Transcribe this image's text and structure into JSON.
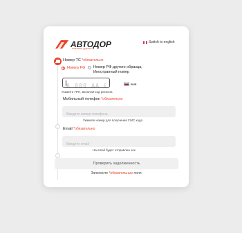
{
  "brand": {
    "name": "АВТОДОР",
    "tagline": "платные дороги",
    "accent": "#e8442a"
  },
  "lang_switch": {
    "label": "Switch to english",
    "flag_icon": "uk-flag-icon"
  },
  "required_mark": "*обязательно",
  "vehicle": {
    "label": "Номер ТС",
    "radio_ru": "Номер РФ",
    "radio_other": "Номер РФ другого образца, Иностранный номер",
    "selected": "radio_ru",
    "plate_placeholder": "А 000 АА 000",
    "region_label": "RUS",
    "hint": "Укажите ГРН, включая код региона"
  },
  "phone": {
    "label": "Мобильный телефон",
    "placeholder": "Введите номер телефона",
    "hint": "Укажите номер для получения СМС кода"
  },
  "email": {
    "label": "Email",
    "placeholder": "Введите email",
    "hint": "На email будет отправлен чек"
  },
  "submit_label": "Проверить задолженность",
  "footer": {
    "before": "Заполните ",
    "required": "*обязательные",
    "after": " поля"
  }
}
